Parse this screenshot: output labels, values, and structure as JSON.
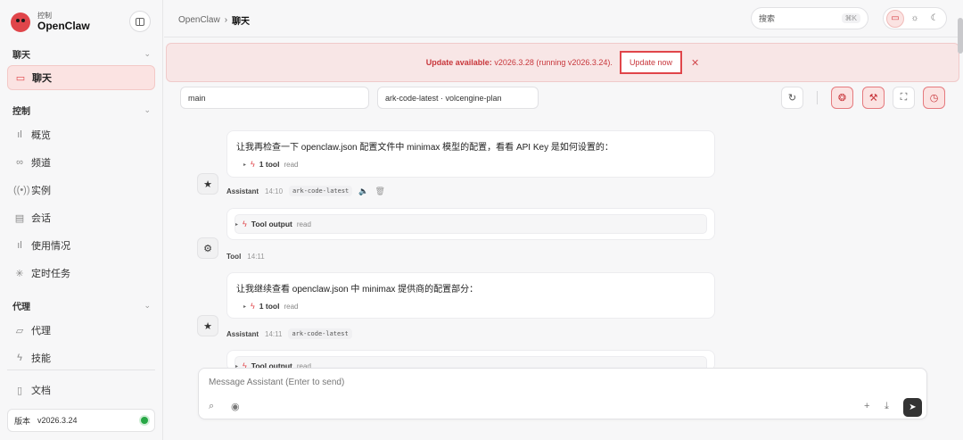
{
  "brand": {
    "sub": "控制",
    "name": "OpenClaw"
  },
  "sidebar": {
    "groups": [
      {
        "label": "聊天"
      },
      {
        "label": "控制"
      },
      {
        "label": "代理"
      }
    ],
    "items": [
      {
        "label": "聊天",
        "icon": "chat-icon"
      },
      {
        "label": "概览",
        "icon": "bar-chart-icon"
      },
      {
        "label": "频道",
        "icon": "link-icon"
      },
      {
        "label": "实例",
        "icon": "broadcast-icon"
      },
      {
        "label": "会话",
        "icon": "document-icon"
      },
      {
        "label": "使用情况",
        "icon": "bar-chart-icon"
      },
      {
        "label": "定时任务",
        "icon": "loader-icon"
      },
      {
        "label": "代理",
        "icon": "folder-icon"
      },
      {
        "label": "技能",
        "icon": "bolt-icon"
      },
      {
        "label": "文档",
        "icon": "book-icon"
      }
    ],
    "version_label": "版本",
    "version_value": "v2026.3.24"
  },
  "topbar": {
    "breadcrumb_root": "OpenClaw",
    "breadcrumb_sep": "›",
    "breadcrumb_current": "聊天",
    "search_placeholder": "搜索",
    "search_shortcut": "⌘K"
  },
  "banner": {
    "title": "Update available:",
    "detail": "v2026.3.28 (running v2026.3.24).",
    "button": "Update now"
  },
  "session": {
    "agent": "main",
    "model": "ark-code-latest · volcengine-plan"
  },
  "messages": [
    {
      "text": "让我再检查一下 openclaw.json 配置文件中 minimax 模型的配置，看看 API Key 是如何设置的：",
      "tool_name": "1 tool",
      "tool_kind": "read",
      "role": "Assistant",
      "time": "14:10",
      "model": "ark-code-latest"
    },
    {
      "tool_name": "Tool output",
      "tool_kind": "read",
      "role": "Tool",
      "time": "14:11"
    },
    {
      "text": "让我继续查看 openclaw.json 中 minimax 提供商的配置部分：",
      "tool_name": "1 tool",
      "tool_kind": "read",
      "role": "Assistant",
      "time": "14:11",
      "model": "ark-code-latest"
    },
    {
      "tool_name": "Tool output",
      "tool_kind": "read"
    }
  ],
  "composer": {
    "placeholder": "Message Assistant (Enter to send)"
  },
  "colors": {
    "accent": "#e0454a",
    "banner_bg": "#f8e6e6",
    "status_ok": "#27a745"
  }
}
